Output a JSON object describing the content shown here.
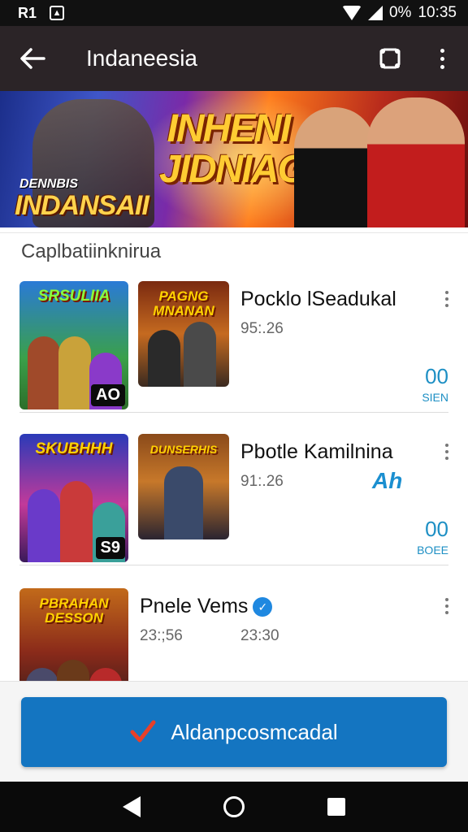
{
  "status_bar": {
    "left_badge": "R1",
    "battery": "0%",
    "time": "10:35"
  },
  "app_bar": {
    "title": "Indaneesia",
    "back_icon": "arrow-left-icon",
    "action_icon": "crop-icon",
    "more_icon": "more-vert-icon"
  },
  "banner": {
    "small_text": "DENNBIS",
    "left_title": "INDANSAII",
    "big_title_line1": "INHENI",
    "big_title_line2": "JIDNIAGI"
  },
  "section": {
    "title": "Caplbatiinknirua"
  },
  "rows": [
    {
      "thumb_a_title": "SRSULIIA",
      "thumb_a_badge": "AO",
      "thumb_b_title": "PAGNG MNANAN",
      "title": "Pocklo lSeadukal",
      "time": "95:.26",
      "count": "00",
      "count_label": "SIEN"
    },
    {
      "thumb_a_title": "SKUBHHH",
      "thumb_a_badge": "S9",
      "thumb_b_title": "DUNSERHIS",
      "title": "Pbotle Kamilnina",
      "time": "91:.26",
      "tag": "Ah",
      "count": "00",
      "count_label": "BOEE"
    },
    {
      "thumb_a_title": "PBRAHAN DESSON",
      "title": "Pnele Vems",
      "time": "23:;56",
      "time2": "23:30"
    }
  ],
  "cta": {
    "label": "Aldanpcosmcadal"
  },
  "colors": {
    "app_bar": "#2b2427",
    "accent": "#1475c1",
    "count_blue": "#1d8fc4"
  }
}
